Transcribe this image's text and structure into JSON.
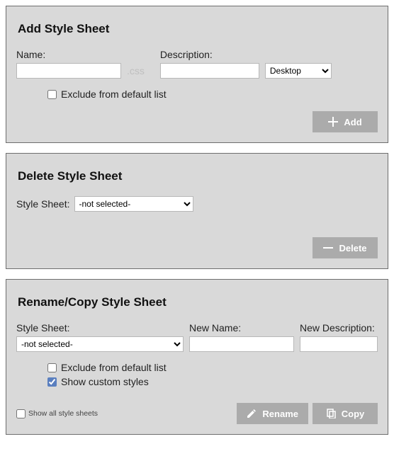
{
  "addPanel": {
    "title": "Add Style Sheet",
    "nameLabel": "Name:",
    "nameValue": "",
    "suffixText": ".css",
    "descriptionLabel": "Description:",
    "descriptionValue": "",
    "typeSelected": "Desktop",
    "typeOptions": [
      "Desktop"
    ],
    "excludeLabel": "Exclude from default list",
    "excludeChecked": false,
    "addButton": "Add"
  },
  "deletePanel": {
    "title": "Delete Style Sheet",
    "sheetLabel": "Style Sheet:",
    "sheetSelected": "-not selected-",
    "sheetOptions": [
      "-not selected-"
    ],
    "deleteButton": "Delete"
  },
  "renamePanel": {
    "title": "Rename/Copy Style Sheet",
    "sheetLabel": "Style Sheet:",
    "sheetSelected": "-not selected-",
    "sheetOptions": [
      "-not selected-"
    ],
    "newNameLabel": "New Name:",
    "newNameValue": "",
    "newDescLabel": "New Description:",
    "newDescValue": "",
    "excludeLabel": "Exclude from default list",
    "excludeChecked": false,
    "showCustomLabel": "Show custom styles",
    "showCustomChecked": true,
    "showAllLabel": "Show all style sheets",
    "showAllChecked": false,
    "renameButton": "Rename",
    "copyButton": "Copy"
  }
}
